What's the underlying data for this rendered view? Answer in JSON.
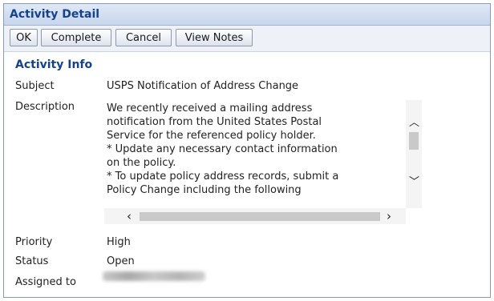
{
  "window": {
    "title": "Activity Detail"
  },
  "toolbar": {
    "ok_label": "OK",
    "complete_label": "Complete",
    "cancel_label": "Cancel",
    "view_notes_label": "View Notes"
  },
  "activity_info": {
    "heading": "Activity Info",
    "subject_label": "Subject",
    "subject_value": "USPS Notification of Address Change",
    "description_label": "Description",
    "description_lines": [
      "We recently received a mailing address",
      "notification from the United States Postal",
      "Service for the referenced policy holder.",
      "* Update any necessary contact information",
      "on the policy.",
      "* To update policy address records, submit a",
      "Policy Change including the following"
    ],
    "priority_label": "Priority",
    "priority_value": "High",
    "status_label": "Status",
    "status_value": "Open",
    "assigned_to_label": "Assigned to"
  },
  "icons": {
    "scroll_up": "chevron-up-icon",
    "scroll_down": "chevron-down-icon",
    "scroll_left": "chevron-left-icon",
    "scroll_right": "chevron-right-icon"
  },
  "colors": {
    "title_text": "#15428b",
    "title_bar": "#c7d6ec",
    "toolbar_bg": "#eef2f8"
  }
}
